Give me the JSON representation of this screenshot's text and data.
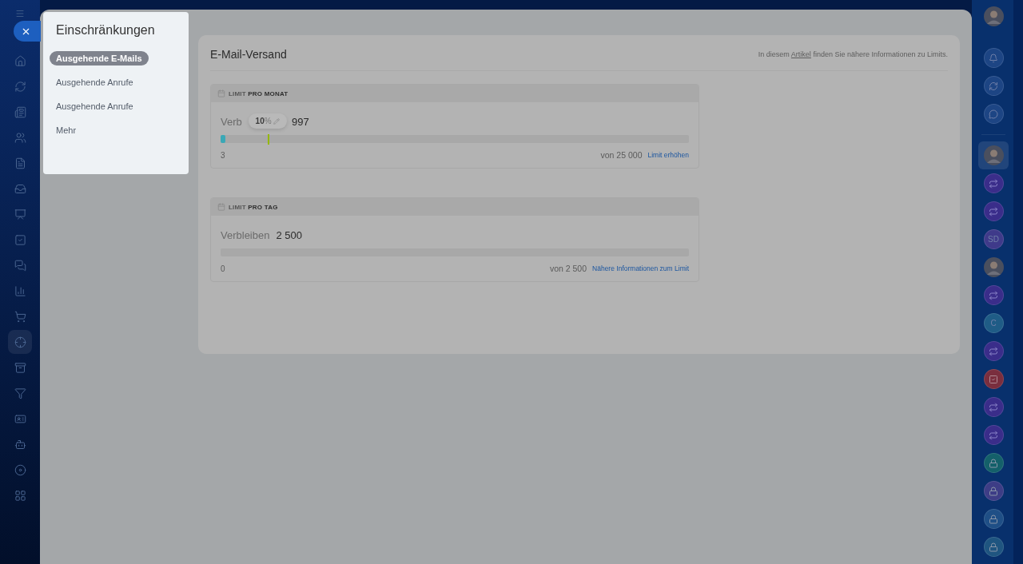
{
  "left_nav": {
    "items": [
      {
        "kind": "home",
        "selected": false
      },
      {
        "kind": "crm",
        "selected": false
      },
      {
        "kind": "feed",
        "selected": false
      },
      {
        "kind": "users",
        "selected": false
      },
      {
        "kind": "file",
        "selected": false
      },
      {
        "kind": "inbox",
        "selected": false
      },
      {
        "kind": "presentation",
        "selected": false
      },
      {
        "kind": "tasks",
        "selected": false
      },
      {
        "kind": "chat",
        "selected": false
      },
      {
        "kind": "chart",
        "selected": false
      },
      {
        "kind": "cart",
        "selected": false
      },
      {
        "kind": "target",
        "selected": true
      },
      {
        "kind": "archive",
        "selected": false
      },
      {
        "kind": "filter",
        "selected": false
      },
      {
        "kind": "card",
        "selected": false
      },
      {
        "kind": "bot",
        "selected": false
      },
      {
        "kind": "disk",
        "selected": false
      },
      {
        "kind": "grid",
        "selected": false
      }
    ]
  },
  "popup": {
    "title": "Einschränkungen",
    "items": [
      {
        "label": "Ausgehende E-Mails",
        "selected": true
      },
      {
        "label": "Ausgehende Anrufe",
        "selected": false
      },
      {
        "label": "Ausgehende Anrufe",
        "selected": false
      },
      {
        "label": "Mehr",
        "selected": false
      }
    ]
  },
  "content": {
    "title": "E-Mail-Versand",
    "note_before": "In diesem",
    "note_link": "Artikel",
    "note_after": "finden Sie nähere Informationen zu Limits.",
    "limits": [
      {
        "label": "LIMIT",
        "label_bold": "PRO MONAT",
        "remaining_label": "Verb",
        "remaining_value": "997",
        "level": 0.01,
        "start": "3",
        "total": "von 25 000",
        "link": "Limit erhöhen",
        "marker": {
          "value": "10",
          "unit": "%",
          "level": 0.1
        }
      },
      {
        "label": "LIMIT",
        "label_bold": "PRO TAG",
        "remaining_label": "Verbleiben",
        "remaining_value": "2 500",
        "start": "0",
        "total": "von 2 500",
        "link": "Nähere Informationen zum Limit"
      }
    ]
  },
  "right_bar": {
    "items": [
      {
        "kind": "avatar",
        "selected": true
      },
      {
        "kind": "openline",
        "selected": false
      },
      {
        "kind": "openline",
        "selected": false
      },
      {
        "kind": "initials",
        "text": "SD",
        "color": "#3f3a8a",
        "selected": false
      },
      {
        "kind": "avatar",
        "selected": false
      },
      {
        "kind": "openline",
        "selected": false
      },
      {
        "kind": "initials",
        "text": "C",
        "color": "#1f5c86",
        "selected": false
      },
      {
        "kind": "openline",
        "selected": false
      },
      {
        "kind": "task",
        "color": "#7a2e3e",
        "selected": false
      },
      {
        "kind": "openline",
        "selected": false
      },
      {
        "kind": "openline",
        "selected": false
      },
      {
        "kind": "lock",
        "color": "#14606a",
        "selected": false
      },
      {
        "kind": "lock",
        "color": "#3d3d86",
        "selected": false
      },
      {
        "kind": "lock",
        "color": "#1f4f86",
        "selected": false
      },
      {
        "kind": "lock",
        "color": "#1f5580",
        "selected": false
      }
    ]
  }
}
